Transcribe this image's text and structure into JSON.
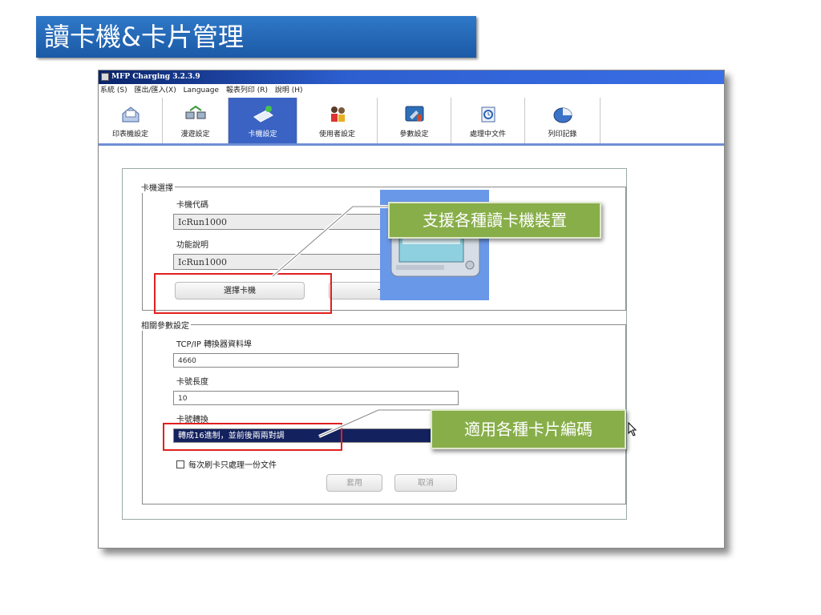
{
  "slide": {
    "title": "讀卡機&卡片管理"
  },
  "window": {
    "title": "MFP Charging 3.2.3.9"
  },
  "menu": {
    "items": [
      "系統 (S)",
      "匯出/匯入(X)",
      "Language",
      "報表列印 (R)",
      "說明 (H)"
    ]
  },
  "toolbar": {
    "items": [
      {
        "label": "印表機設定",
        "icon": "printer-doc-icon"
      },
      {
        "label": "漫遊設定",
        "icon": "roaming-printers-icon"
      },
      {
        "label": "卡機設定",
        "icon": "card-reader-icon"
      },
      {
        "label": "使用者設定",
        "icon": "users-icon"
      },
      {
        "label": "參數設定",
        "icon": "parameter-tools-icon"
      },
      {
        "label": "處理中文件",
        "icon": "processing-doc-icon"
      },
      {
        "label": "列印記錄",
        "icon": "pie-chart-icon"
      }
    ]
  },
  "reader_group": {
    "legend": "卡機選擇",
    "code_label": "卡機代碼",
    "code_value": "IcRun1000",
    "desc_label": "功能說明",
    "desc_value": "IcRun1000",
    "select_button": "選擇卡機",
    "params_button": "卡機參數"
  },
  "params_group": {
    "legend": "相關參數設定",
    "port_label": "TCP/IP 轉換器資料埠",
    "port_value": "4660",
    "length_label": "卡號長度",
    "length_value": "10",
    "convert_label": "卡號轉換",
    "convert_value": "轉成16進制，並前後兩兩對調",
    "checkbox_label": "每次刷卡只處理一份文件",
    "apply_button": "套用",
    "cancel_button": "取消"
  },
  "callouts": {
    "top": "支援各種讀卡機裝置",
    "bottom": "適用各種卡片編碼"
  },
  "colors": {
    "title_bg": "#1f63b4",
    "callout_bg": "#88ae4a",
    "highlight": "#e02020",
    "selected_bg": "#13215e"
  }
}
